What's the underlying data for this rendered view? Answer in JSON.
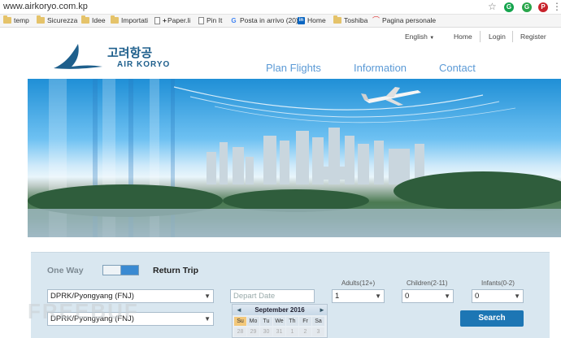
{
  "browser": {
    "url": "www.airkoryo.com.kp",
    "bookmarks": [
      "temp",
      "Sicurezza",
      "Idee",
      "Importati",
      "Paper.li",
      "Pin It",
      "Posta in arrivo (20)",
      "Home",
      "Toshiba",
      "Pagina personale"
    ]
  },
  "header": {
    "lang": "English",
    "links": [
      "Home",
      "Login",
      "Register"
    ],
    "logo_korean": "고려항공",
    "logo_text": "AIR KORYO",
    "nav": [
      "Plan Flights",
      "Information",
      "Contact"
    ]
  },
  "booking": {
    "one_way": "One Way",
    "return_trip": "Return Trip",
    "from": "DPRK/Pyongyang (FNJ)",
    "to": "DPRK/Pyongyang (FNJ)",
    "depart_placeholder": "Depart Date",
    "adults_label": "Adults(12+)",
    "children_label": "Children(2-11)",
    "infants_label": "Infants(0-2)",
    "adults": "1",
    "children": "0",
    "infants": "0",
    "search": "Search"
  },
  "calendar": {
    "prev": "◄",
    "next": "►",
    "month": "September 2016",
    "days_of_week": [
      "Su",
      "Mo",
      "Tu",
      "We",
      "Th",
      "Fr",
      "Sa"
    ],
    "first_row": [
      "28",
      "29",
      "30",
      "31",
      "1",
      "2",
      "3"
    ]
  },
  "watermark": "FREEBUF",
  "colors": {
    "nav": "#5b9ad6",
    "search_button": "#1d76b4",
    "panel_bg": "#d9e7f0"
  }
}
